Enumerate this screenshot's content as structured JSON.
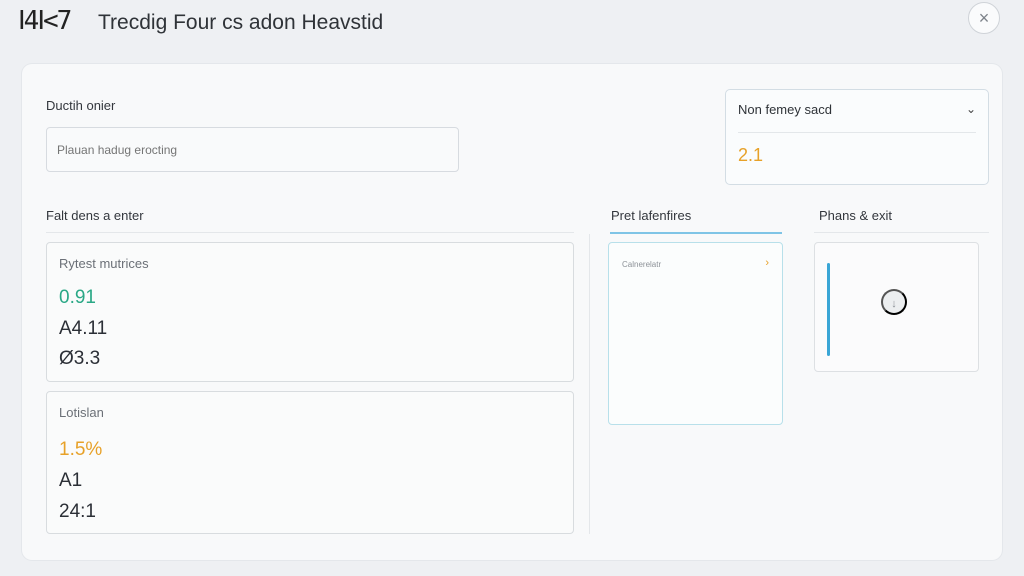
{
  "header": {
    "logo_text": "Ⅰ4Ⅰ<7",
    "title": "Trecdig Four cs adon Heavstid",
    "close_glyph": "×"
  },
  "form": {
    "name_label": "Ductih onier",
    "search_placeholder": "Plauan hadug erocting",
    "select": {
      "value": "Non femey sacd",
      "chevron": "⌄",
      "count": "2.1"
    }
  },
  "sections": {
    "left_label": "Falt dens a enter",
    "mid_tab_label": "Pret lafenfires",
    "right_label": "Phans & exit"
  },
  "cards": {
    "metrics_card": {
      "title": "Rytest mutrices",
      "values": [
        "0.91",
        "A4.11",
        "Ø3.3"
      ]
    },
    "lotislan_card": {
      "title": "Lotislan",
      "values": [
        "1.5%",
        "A1",
        "24:1"
      ]
    }
  },
  "preview": {
    "label": "Calnerelatr",
    "arrow": "›"
  },
  "exit": {
    "add_glyph": "↓"
  },
  "colors": {
    "accent_orange": "#e7a128",
    "accent_green": "#2aa886",
    "accent_blue": "#3aa6d6"
  }
}
